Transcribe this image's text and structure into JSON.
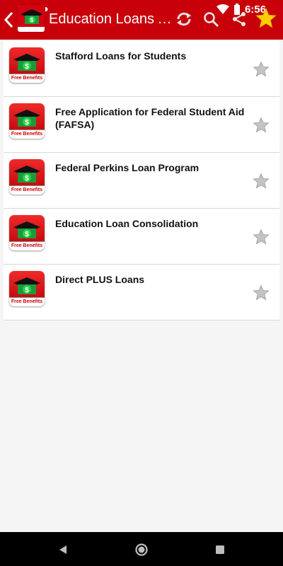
{
  "status_bar": {
    "time": "6:56",
    "icons": [
      "settings-icon",
      "sd-card-icon",
      "circle-icon",
      "wifi-icon",
      "battery-icon"
    ]
  },
  "app_bar": {
    "title": "Education Loans A...",
    "logo_text": "Free Benefits",
    "actions": [
      "refresh-icon",
      "search-icon",
      "share-icon",
      "star-icon"
    ]
  },
  "list": {
    "items": [
      {
        "label": "Stafford Loans for Students",
        "icon_text": "Free Benefits"
      },
      {
        "label": "Free Application for Federal Student Aid (FAFSA)",
        "icon_text": "Free Benefits"
      },
      {
        "label": "Federal Perkins Loan Program",
        "icon_text": "Free Benefits"
      },
      {
        "label": "Education Loan Consolidation",
        "icon_text": "Free Benefits"
      },
      {
        "label": "Direct PLUS Loans",
        "icon_text": "Free Benefits"
      }
    ]
  },
  "nav_bar": {
    "buttons": [
      "back-triangle-icon",
      "home-circle-icon",
      "recents-square-icon"
    ]
  },
  "colors": {
    "app_bar": "#c8000a",
    "list_bg": "#ffffff",
    "page_bg": "#f5f5f5",
    "star_gray": "#bdbdbd",
    "star_gold": "#ffcc00"
  }
}
